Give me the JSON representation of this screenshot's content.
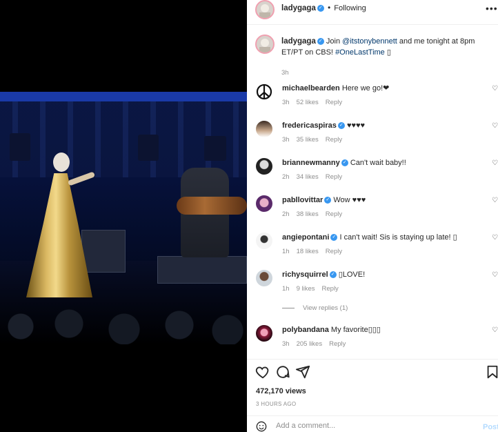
{
  "header": {
    "username": "ladygaga",
    "separator": "•",
    "follow_status": "Following",
    "more_icon": "more-icon"
  },
  "caption": {
    "username": "ladygaga",
    "text_prefix": "Join ",
    "mention": "@itstonybennett",
    "text_mid": " and me tonight at 8pm ET/PT on CBS! ",
    "hashtag": "#OneLastTime",
    "text_suffix": " ▯",
    "time": "3h"
  },
  "comments": [
    {
      "user": "michaelbearden",
      "verified": false,
      "text": "Here we go!❤",
      "time": "3h",
      "likes": "52 likes",
      "reply": "Reply"
    },
    {
      "user": "fredericaspiras",
      "verified": true,
      "text": "♥♥♥♥",
      "time": "3h",
      "likes": "35 likes",
      "reply": "Reply"
    },
    {
      "user": "briannewmanny",
      "verified": true,
      "text": "Can't wait baby!!",
      "time": "2h",
      "likes": "34 likes",
      "reply": "Reply"
    },
    {
      "user": "pabllovittar",
      "verified": true,
      "text": "Wow ♥♥♥",
      "time": "2h",
      "likes": "38 likes",
      "reply": "Reply"
    },
    {
      "user": "angiepontani",
      "verified": true,
      "text": "I can't wait! Sis is staying up late! ▯",
      "time": "1h",
      "likes": "18 likes",
      "reply": "Reply"
    },
    {
      "user": "richysquirrel",
      "verified": true,
      "text": "▯LOVE!",
      "time": "1h",
      "likes": "9 likes",
      "reply": "Reply"
    },
    {
      "user": "polybandana",
      "verified": false,
      "text": "My favorite▯▯▯",
      "time": "3h",
      "likes": "205 likes",
      "reply": "Reply"
    }
  ],
  "view_replies": "View replies (1)",
  "views": "472,170 views",
  "posted": "3 HOURS AGO",
  "add_comment": {
    "placeholder": "Add a comment...",
    "post_label": "Post"
  },
  "colors": {
    "verified": "#3897f0",
    "link": "#00376b",
    "muted": "#8e8e8e",
    "post_disabled": "#b3dbff"
  }
}
